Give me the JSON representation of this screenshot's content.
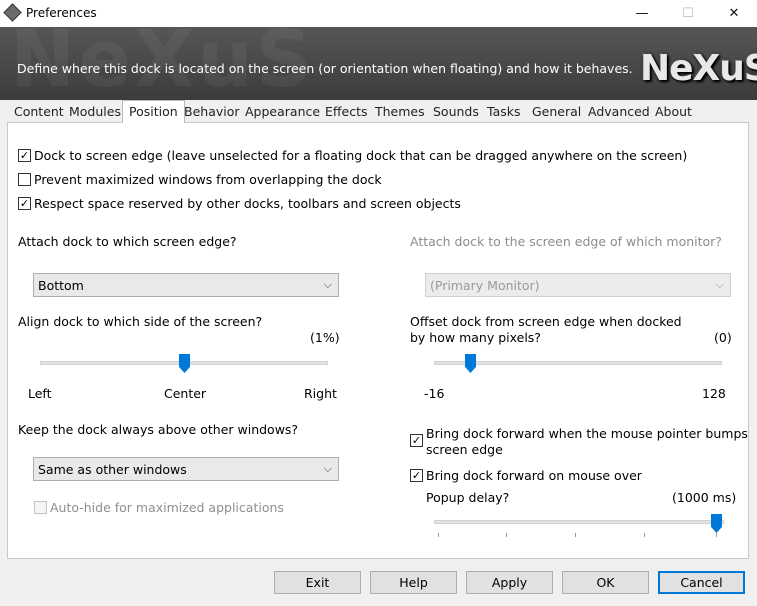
{
  "window": {
    "title": "Preferences",
    "min_glyph": "—",
    "max_glyph": "☐",
    "close_glyph": "✕"
  },
  "banner": {
    "description": "Define where this dock is located on the screen (or orientation when floating) and how it behaves.",
    "logo_text": "NeXuS",
    "watermark_text": "NeXuS"
  },
  "tabs": [
    "Content",
    "Modules",
    "Position",
    "Behavior",
    "Appearance",
    "Effects",
    "Themes",
    "Sounds",
    "Tasks",
    "General",
    "Advanced",
    "About"
  ],
  "active_tab": "Position",
  "options": {
    "dock_to_edge": {
      "label": "Dock to screen edge (leave unselected for a floating dock that can be dragged anywhere on the screen)",
      "checked": true
    },
    "prevent_overlap": {
      "label": "Prevent maximized windows from overlapping the dock",
      "checked": false
    },
    "respect_space": {
      "label": "Respect space reserved by other docks, toolbars and screen objects",
      "checked": true
    }
  },
  "attach_edge": {
    "label": "Attach dock to which screen edge?",
    "value": "Bottom"
  },
  "attach_monitor": {
    "label": "Attach dock to the screen edge of which monitor?",
    "value": "(Primary Monitor)"
  },
  "align": {
    "label": "Align dock to which side of the screen?",
    "value_text": "(1%)",
    "value": 1,
    "min_label": "Left",
    "mid_label": "Center",
    "max_label": "Right"
  },
  "offset": {
    "label_line1": "Offset dock from screen edge when docked",
    "label_line2": "by how many pixels?",
    "value_text": "(0)",
    "value": 0,
    "min_label": "-16",
    "max_label": "128"
  },
  "keep_above": {
    "label": "Keep the dock always above other windows?",
    "value": "Same as other windows"
  },
  "auto_hide": {
    "label": "Auto-hide for maximized applications",
    "checked": false
  },
  "bring_forward_bump": {
    "label_line1": "Bring dock forward when the mouse pointer bumps",
    "label_line2": "screen edge",
    "checked": true
  },
  "bring_forward_over": {
    "label": "Bring dock forward on mouse over",
    "checked": true
  },
  "popup_delay": {
    "label": "Popup delay?",
    "value_text": "(1000 ms)",
    "fraction": 1.0
  },
  "buttons": {
    "exit": "Exit",
    "help": "Help",
    "apply": "Apply",
    "ok": "OK",
    "cancel": "Cancel"
  },
  "check_glyph": "✓",
  "dropdown_glyph": "⌵",
  "colors": {
    "accent": "#0078d7",
    "banner": "#4a4a4a"
  }
}
